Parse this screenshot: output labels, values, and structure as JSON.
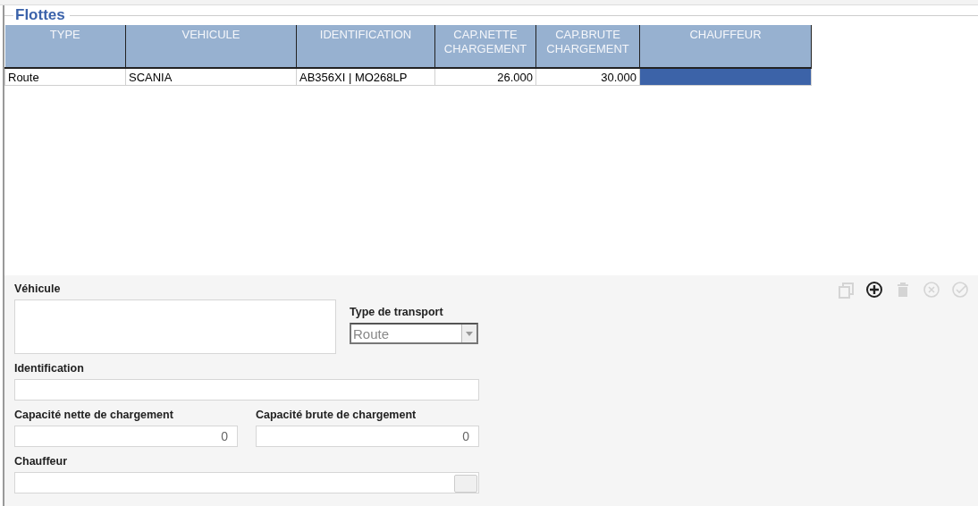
{
  "section": {
    "title": "Flottes"
  },
  "table": {
    "columns": [
      {
        "label": "TYPE"
      },
      {
        "label": "VEHICULE"
      },
      {
        "label": "IDENTIFICATION"
      },
      {
        "label": "CAP.NETTE CHARGEMENT"
      },
      {
        "label": "CAP.BRUTE CHARGEMENT"
      },
      {
        "label": "CHAUFFEUR"
      }
    ],
    "rows": [
      {
        "cells": [
          "Route",
          "SCANIA",
          "AB356XI | MO268LP",
          "26.000",
          "30.000"
        ],
        "selected": true
      }
    ]
  },
  "toolbar": [
    {
      "kind": "copy",
      "disabled": true
    },
    {
      "kind": "add",
      "disabled": false
    },
    {
      "kind": "delete",
      "disabled": true
    },
    {
      "kind": "cancel",
      "disabled": true
    },
    {
      "kind": "confirm",
      "disabled": true
    }
  ],
  "form": {
    "vehicule": {
      "label": "Véhicule"
    },
    "type_transport": {
      "label": "Type de transport",
      "value": "Route"
    },
    "identification": {
      "label": "Identification"
    },
    "cap_nette": {
      "label": "Capacité nette de chargement",
      "value": "0"
    },
    "cap_brute": {
      "label": "Capacité brute de chargement",
      "value": "0"
    },
    "chauffeur": {
      "label": "Chauffeur"
    }
  }
}
